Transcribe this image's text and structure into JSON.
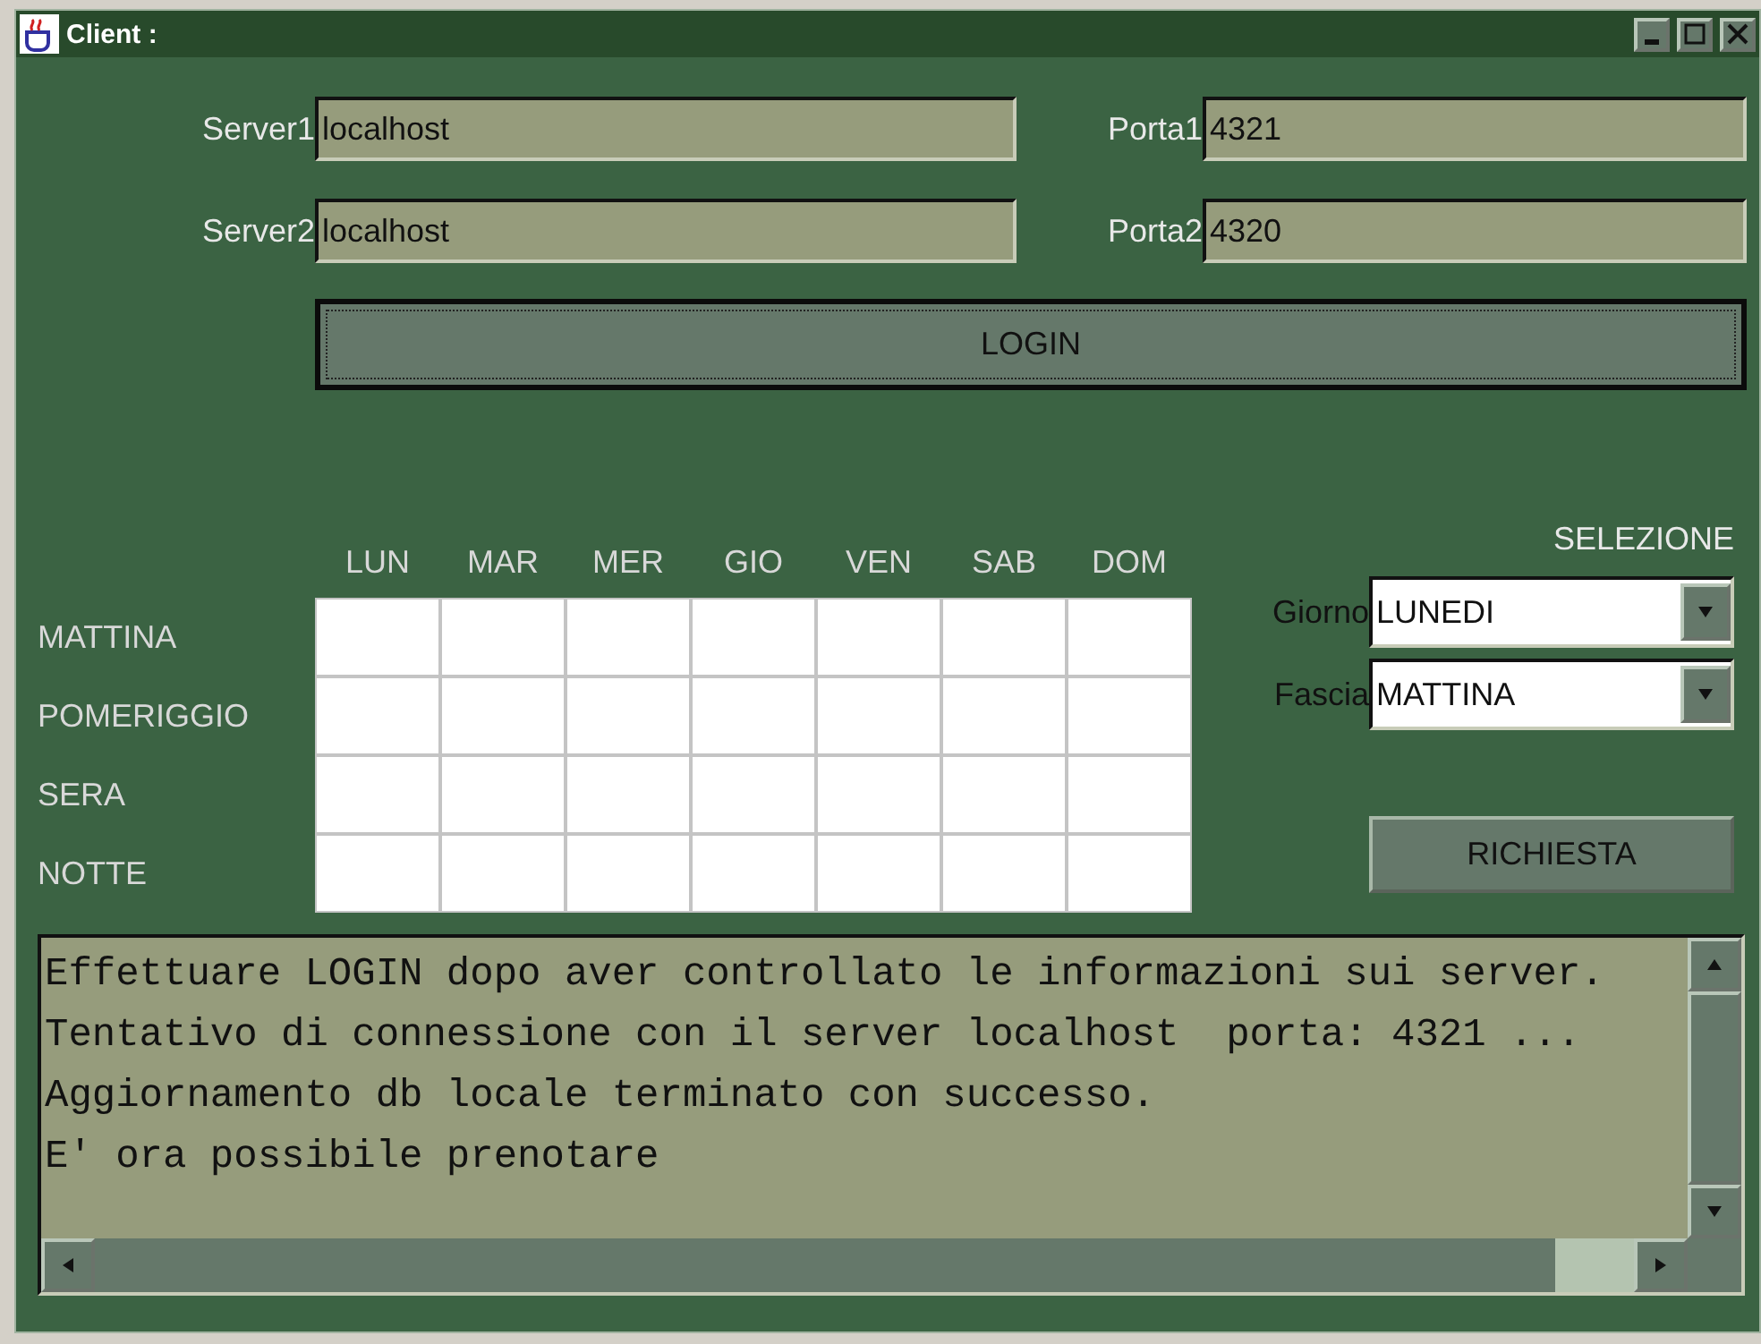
{
  "window": {
    "title": "Client :"
  },
  "servers": [
    {
      "label": "Server1",
      "value": "localhost",
      "port_label": "Porta1",
      "port": "4321"
    },
    {
      "label": "Server2",
      "value": "localhost",
      "port_label": "Porta2",
      "port": "4320"
    }
  ],
  "login_button": "LOGIN",
  "schedule": {
    "days": [
      "LUN",
      "MAR",
      "MER",
      "GIO",
      "VEN",
      "SAB",
      "DOM"
    ],
    "slots": [
      "MATTINA",
      "POMERIGGIO",
      "SERA",
      "NOTTE"
    ]
  },
  "selection": {
    "title": "SELEZIONE",
    "fields": [
      {
        "label": "Giorno",
        "value": "LUNEDI"
      },
      {
        "label": "Fascia",
        "value": "MATTINA"
      }
    ],
    "button": "RICHIESTA"
  },
  "log": [
    "Effettuare LOGIN dopo aver controllato le informazioni sui server.",
    "Tentativo di connessione con il server localhost  porta: 4321 ...",
    "Aggiornamento db locale terminato con successo.",
    "E' ora possibile prenotare"
  ]
}
